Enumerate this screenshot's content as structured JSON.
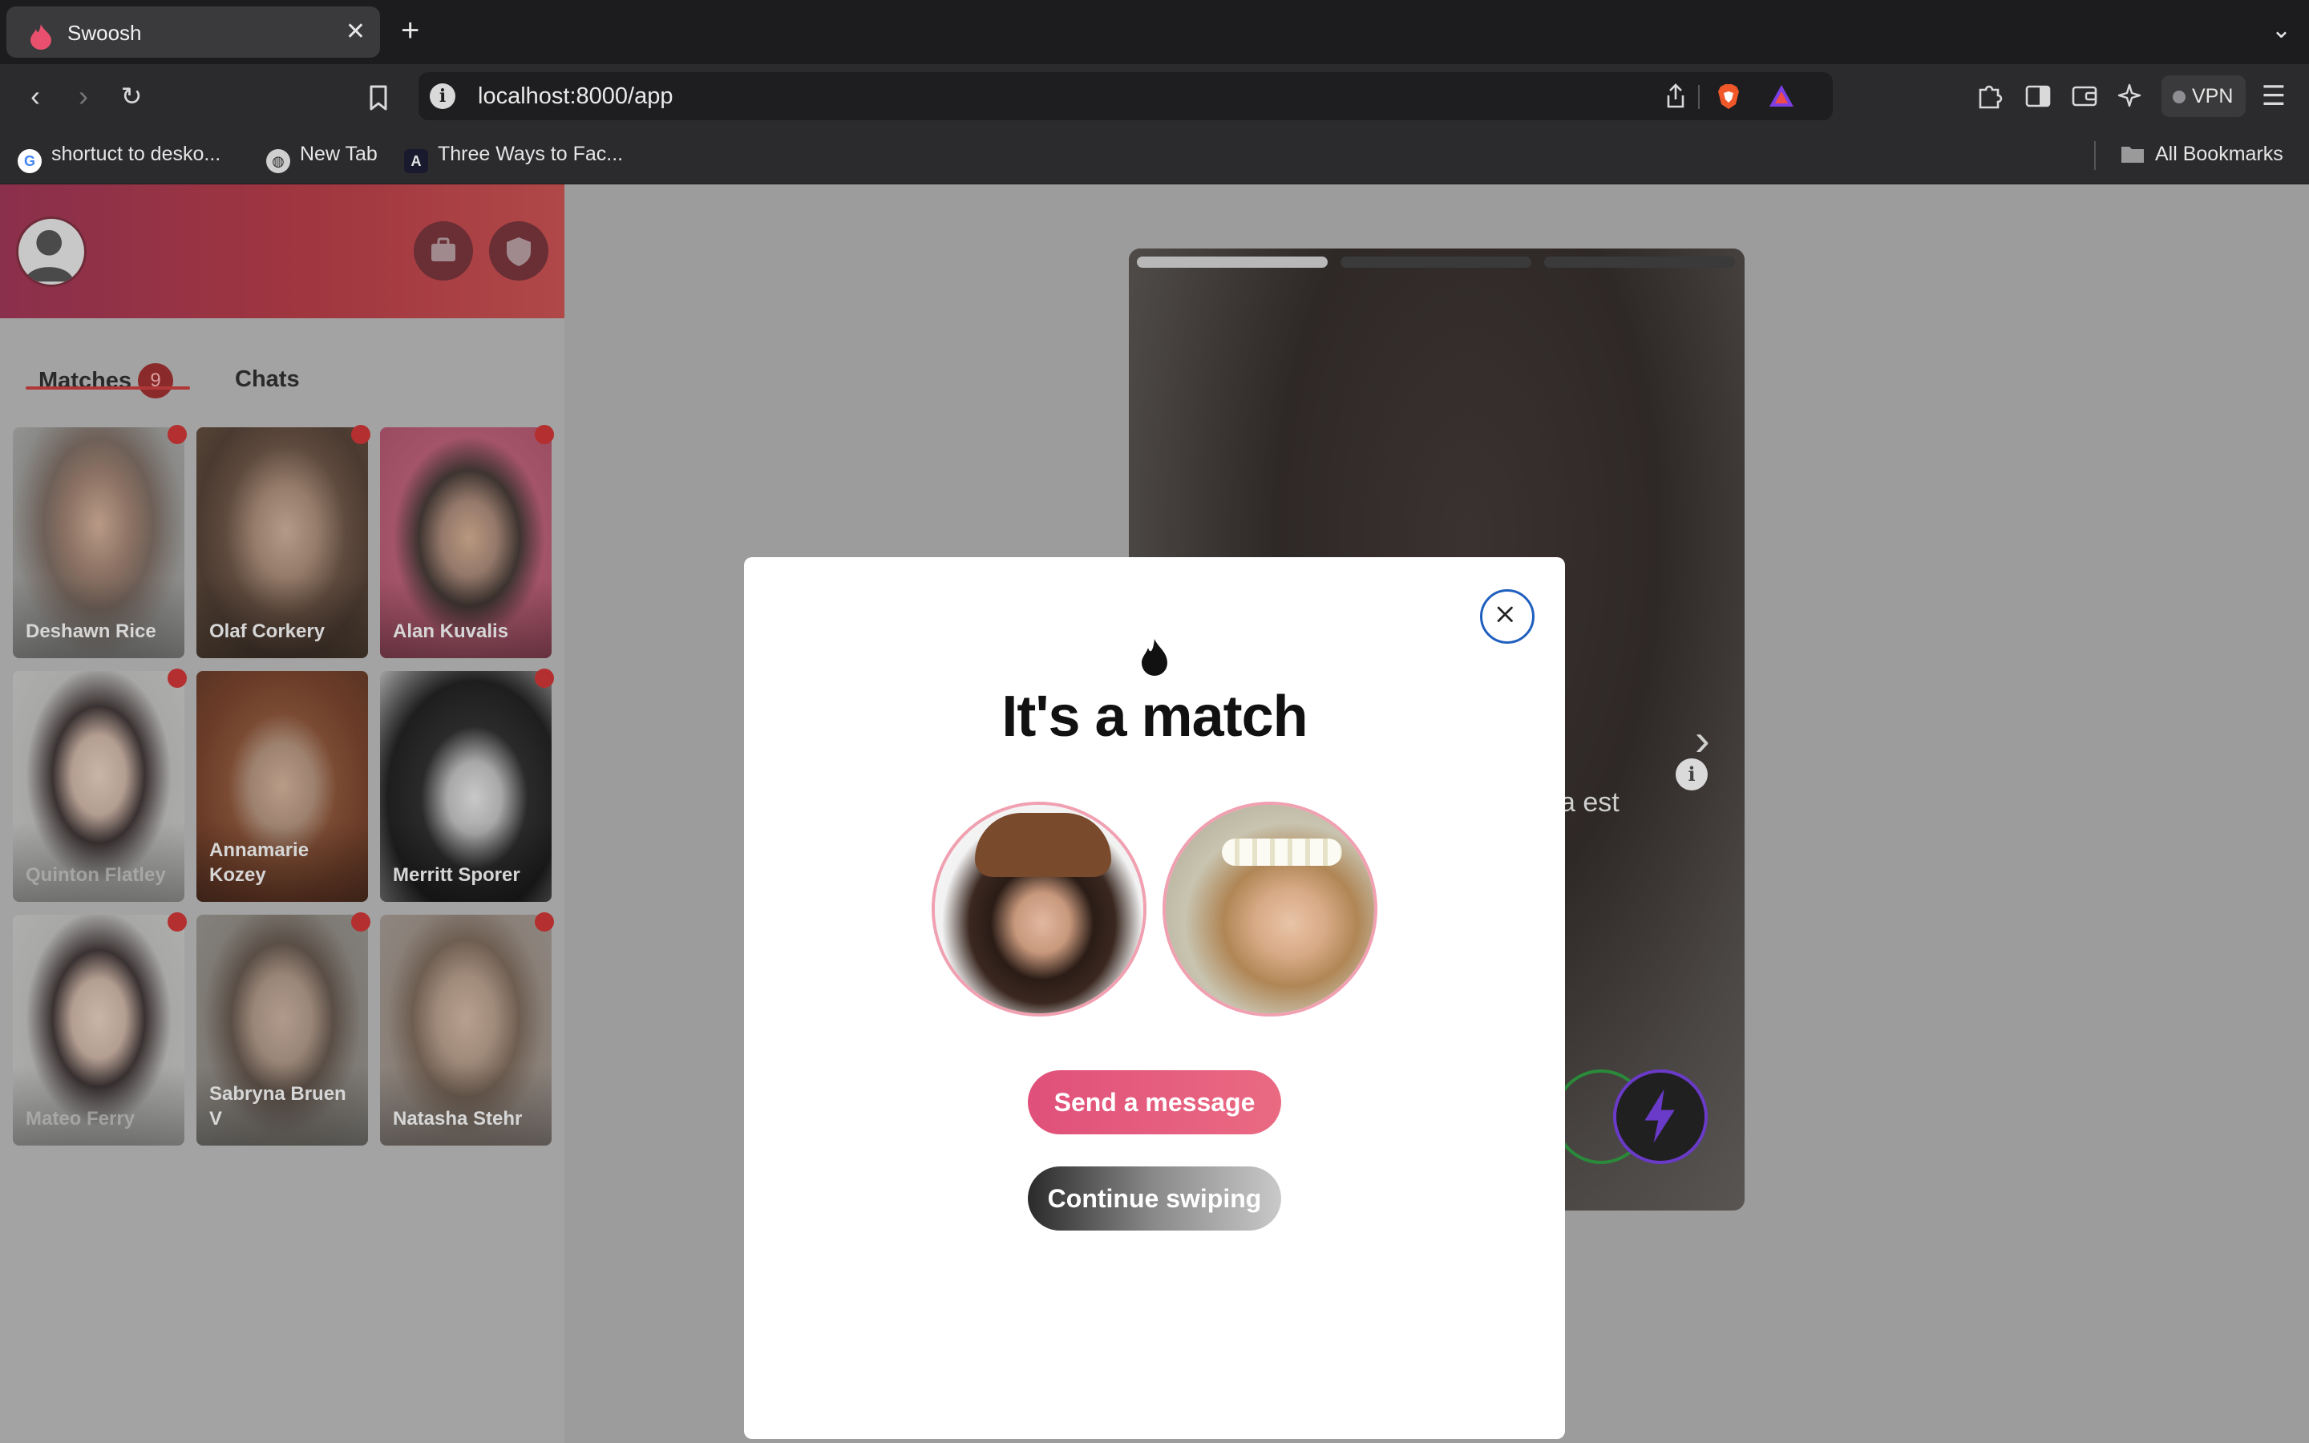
{
  "browser": {
    "tab_title": "Swoosh",
    "url": "localhost:8000/app",
    "vpn_label": "VPN",
    "bookmarks": [
      {
        "label": "shortuct to desko...",
        "icon": "google-icon"
      },
      {
        "label": "New Tab",
        "icon": "globe-icon"
      },
      {
        "label": "Three Ways to Fac...",
        "icon": "a-logo-icon"
      }
    ],
    "all_bookmarks": "All Bookmarks"
  },
  "sidebar": {
    "tabs": {
      "matches_label": "Matches",
      "matches_count": "9",
      "chats_label": "Chats"
    },
    "matches": [
      {
        "name": "Deshawn Rice"
      },
      {
        "name": "Olaf Corkery"
      },
      {
        "name": "Alan Kuvalis"
      },
      {
        "name": "Quinton Flatley"
      },
      {
        "name": "Annamarie Kozey"
      },
      {
        "name": "Merritt Sporer"
      },
      {
        "name": "Mateo Ferry"
      },
      {
        "name": "Sabryna Bruen V"
      },
      {
        "name": "Natasha Stehr"
      }
    ]
  },
  "profile": {
    "partial_text": "a est"
  },
  "modal": {
    "title": "It's a match",
    "send_label": "Send a message",
    "continue_label": "Continue swiping"
  },
  "colors": {
    "brand_pink": "#e0507a",
    "unread_dot": "#b42f2f",
    "close_ring": "#1f5fbf"
  }
}
